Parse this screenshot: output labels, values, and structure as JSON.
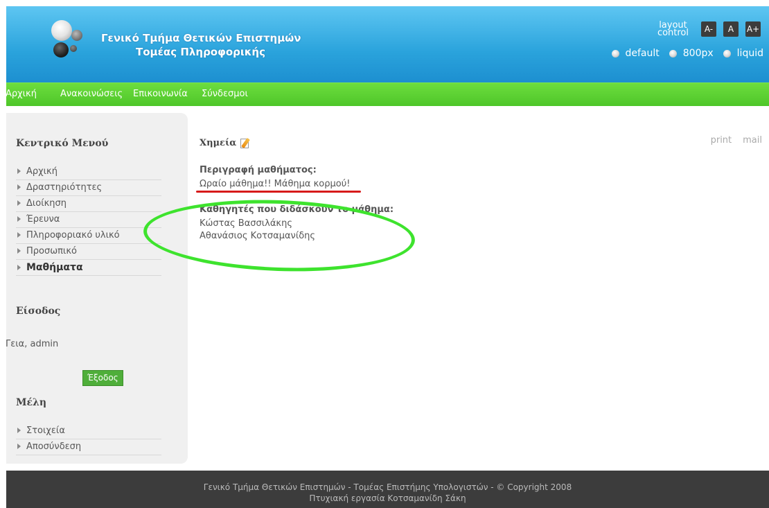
{
  "header": {
    "title_line1": "Γενικό Τμήμα Θετικών Επιστημών",
    "title_line2": "Τομέας Πληροφορικής",
    "layout_label_1": "layout",
    "layout_label_2": "control",
    "font_buttons": [
      "A-",
      "A",
      "A+"
    ],
    "width_options": [
      "default",
      "800px",
      "liquid"
    ]
  },
  "nav": [
    "Αρχική",
    "Ανακοινώσεις",
    "Επικοινωνία",
    "Σύνδεσμοι"
  ],
  "sidebar": {
    "main_menu_title": "Κεντρικό Μενού",
    "main_menu": [
      "Αρχική",
      "Δραστηριότητες",
      "Διοίκηση",
      "Έρευνα",
      "Πληροφοριακό υλικό",
      "Προσωπικό",
      "Μαθήματα"
    ],
    "login_title": "Είσοδος",
    "greeting": "Γεια, admin",
    "logout_label": "Έξοδος",
    "members_title": "Μέλη",
    "members_menu": [
      "Στοιχεία",
      "Αποσύνδεση"
    ]
  },
  "main": {
    "title": "Χημεία",
    "print_label": "print",
    "mail_label": "mail",
    "description_label": "Περιγραφή μαθήματος:",
    "description_text": "Ωραίο μάθημα!! Μάθημα κορμού!",
    "teachers_label": "Καθηγητές που διδάσκουν το μάθημα:",
    "teachers": [
      "Κώστας Βασσιλάκης",
      "Αθανάσιος Κοτσαμανίδης"
    ]
  },
  "footer": {
    "line1": "Γενικό Τμήμα Θετικών Επιστημών - Τομέας Επιστήμης Υπολογιστών - © Copyright 2008",
    "line2": "Πτυχιακή εργασία Κοτσαμανίδη Σάκη"
  },
  "colors": {
    "header_blue": "#2aa3dc",
    "nav_green": "#4ec629",
    "logout_green": "#4fae3a",
    "annotation_red": "#d71a1a",
    "annotation_green": "#3ee32e",
    "footer_dark": "#3c3c3c"
  }
}
